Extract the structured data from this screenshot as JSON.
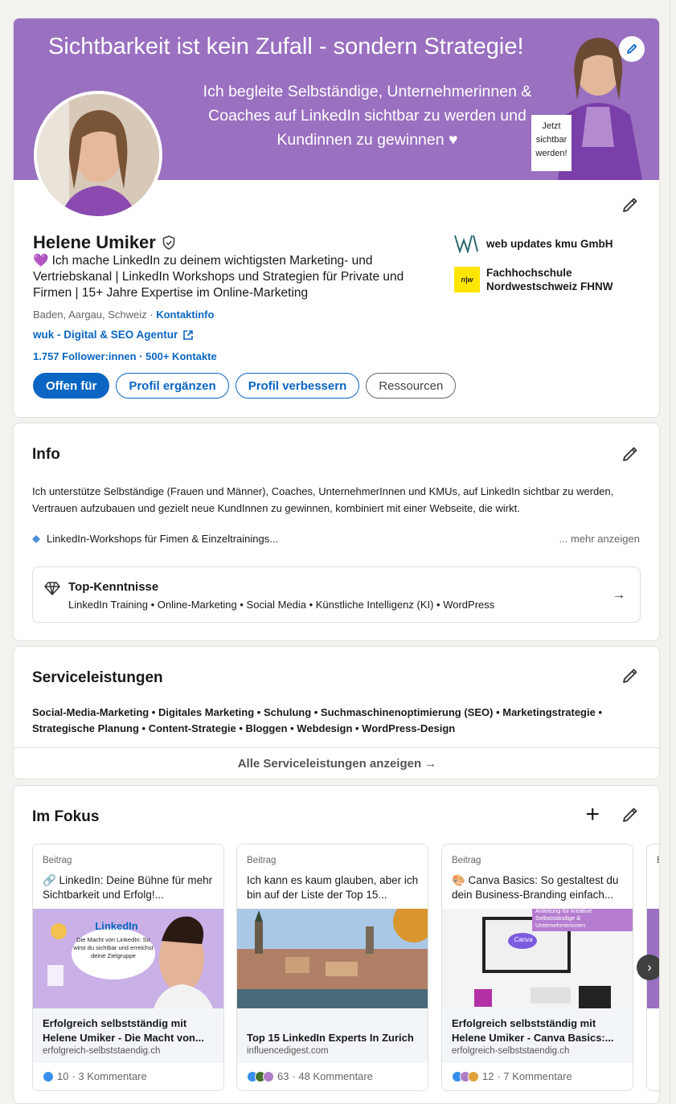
{
  "banner": {
    "headline": "Sichtbarkeit ist kein Zufall - sondern Strategie!",
    "subline": "Ich begleite Selbständige, Unternehmerinnen & Coaches auf LinkedIn sichtbar zu werden und Kundinnen zu gewinnen ♥",
    "sign": "Jetzt sichtbar werden!"
  },
  "profile": {
    "name": "Helene Umiker",
    "headline": "💜 Ich mache LinkedIn zu deinem wichtigsten Marketing- und Vertriebskanal | LinkedIn Workshops und Strategien für Private und Firmen | 15+ Jahre Expertise im Online-Marketing",
    "location": "Baden, Aargau, Schweiz ·",
    "contact_info": "Kontaktinfo",
    "website": "wuk - Digital & SEO Agentur",
    "followers": "1.757 Follower:innen",
    "connections": "· 500+ Kontakte",
    "buttons": {
      "open_to": "Offen für",
      "add_section": "Profil ergänzen",
      "enhance": "Profil verbessern",
      "resources": "Ressourcen"
    },
    "orgs": [
      {
        "name": "web updates kmu GmbH"
      },
      {
        "name": "Fachhochschule Nordwestschweiz FHNW",
        "logo_text": "n|w"
      }
    ]
  },
  "info": {
    "title": "Info",
    "text": "Ich unterstütze Selbständige (Frauen und Männer), Coaches, UnternehmerInnen und KMUs, auf LinkedIn sichtbar zu werden, Vertrauen aufzubauen und gezielt neue KundInnen zu gewinnen, kombiniert mit einer Webseite, die wirkt.",
    "bullet": "LinkedIn-Workshops für Fimen & Einzeltrainings...",
    "more": "... mehr anzeigen",
    "top_skills_title": "Top-Kenntnisse",
    "top_skills": "LinkedIn Training • Online-Marketing • Social Media • Künstliche Intelligenz (KI) • WordPress"
  },
  "services": {
    "title": "Serviceleistungen",
    "list": "Social-Media-Marketing • Digitales Marketing • Schulung • Suchmaschinenoptimierung (SEO) • Marketingstrategie • Strategische Planung • Content-Strategie • Bloggen • Webdesign • WordPress-Design",
    "show_all": "Alle Serviceleistungen anzeigen →"
  },
  "focus": {
    "title": "Im Fokus",
    "posts": [
      {
        "type": "Beitrag",
        "text": "🔗 LinkedIn: Deine Bühne für mehr Sichtbarkeit und Erfolg!...",
        "image_caption": "LinkedIn",
        "image_caption2": "Die Macht von LinkedIn: So wirst du sichtbar und erreichst deine Zielgruppe",
        "link_title": "Erfolgreich selbstständig mit Helene Umiker - Die Macht von...",
        "link_domain": "erfolgreich-selbststaendig.ch",
        "reactions": "10",
        "comments": "· 3 Kommentare"
      },
      {
        "type": "Beitrag",
        "text": "Ich kann es kaum glauben, aber ich bin auf der Liste der Top 15...",
        "link_title": "Top 15 LinkedIn Experts In Zurich",
        "link_domain": "influencedigest.com",
        "reactions": "63",
        "comments": "· 48 Kommentare"
      },
      {
        "type": "Beitrag",
        "text": "🎨 Canva Basics: So gestaltest du dein Business-Branding einfach...",
        "image_caption": "Anleitung für kreative Selbstständige & Unternehmerinnen",
        "image_caption2": "Canva",
        "link_title": "Erfolgreich selbstständig mit Helene Umiker - Canva Basics:...",
        "link_domain": "erfolgreich-selbststaendig.ch",
        "reactions": "12",
        "comments": "· 7 Kommentare"
      },
      {
        "type": "Be"
      }
    ]
  },
  "colors": {
    "brand_blue": "#0a66c2",
    "banner_purple": "#9a70c0"
  }
}
